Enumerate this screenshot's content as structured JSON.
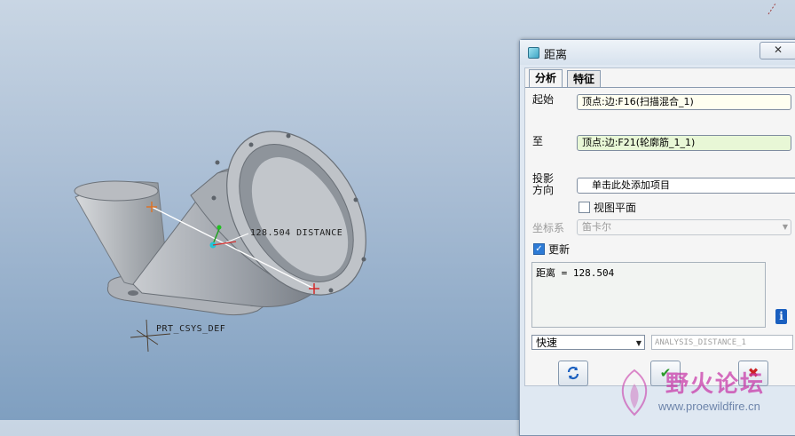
{
  "viewport": {
    "dimension_label": "128.504  DISTANCE",
    "csys_label": "PRT_CSYS_DEF"
  },
  "dialog": {
    "title": "距离",
    "close_label": "✕",
    "tabs": [
      "分析",
      "特征"
    ],
    "from_label": "起始",
    "from_value": "顶点:边:F16(扫描混合_1)",
    "to_label": "至",
    "to_value": "顶点:边:F21(轮廓筋_1_1)",
    "projection_label_line1": "投影",
    "projection_label_line2": "方向",
    "projection_value": "单击此处添加项目",
    "view_plane_label": "视图平面",
    "view_plane_checked": false,
    "csys_label": "坐标系",
    "csys_value": "笛卡尔",
    "update_label": "更新",
    "update_checked": true,
    "result_text": "距离  = 128.504",
    "mode_value": "快速",
    "feature_name": "ANALYSIS_DISTANCE_1"
  },
  "watermark": {
    "brand": "野火论坛",
    "url": "www.proewildfire.cn"
  },
  "colors": {
    "accent": "#2d7bd6",
    "field_to_bg": "#e8f7d6",
    "ok_icon": "#2a9a2a",
    "cancel_icon": "#cc2222"
  }
}
